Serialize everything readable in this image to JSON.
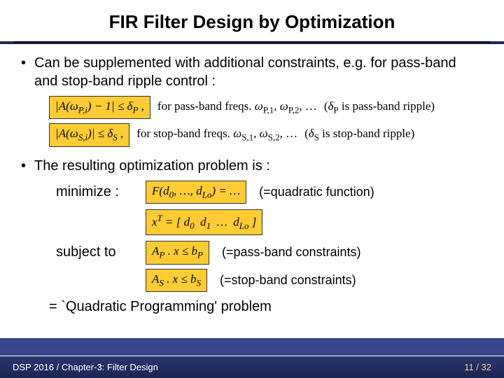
{
  "title": "FIR Filter Design by Optimization",
  "bullets": {
    "b1": "Can be supplemented with additional constraints, e.g. for pass-band and stop-band ripple control :",
    "b2": "The resulting optimization problem is :"
  },
  "formulas": {
    "pass_ineq": "|A(ω_{P,i}) − 1| ≤ δ_P ,",
    "pass_note": "for pass-band freqs. ω_{P,1}, ω_{P,2}, …",
    "pass_ripple": "(δ_P is pass-band ripple)",
    "stop_ineq": "|A(ω_{S,i})| ≤ δ_S ,",
    "stop_note": "for stop-band freqs. ω_{S,1}, ω_{S,2}, …",
    "stop_ripple": "(δ_S is stop-band ripple)",
    "minimize_label": "minimize :",
    "objective": "F(d₀, …, d_{Lo}) = …",
    "quad_note": "(=quadratic function)",
    "xvec": "xᵀ = [ d₀  d₁  …  d_{Lo} ]",
    "subject_label": "subject to",
    "pass_constr": "A_P · x ≤ b_P",
    "pass_constr_note": "(=pass-band constraints)",
    "stop_constr": "A_S · x ≤ b_S",
    "stop_constr_note": "(=stop-band constraints)",
    "conclusion": "=  `Quadratic Programming' problem"
  },
  "footer": {
    "left": "DSP 2016 / Chapter-3: Filter Design",
    "page_current": "11",
    "page_sep": " / ",
    "page_total": "32"
  }
}
